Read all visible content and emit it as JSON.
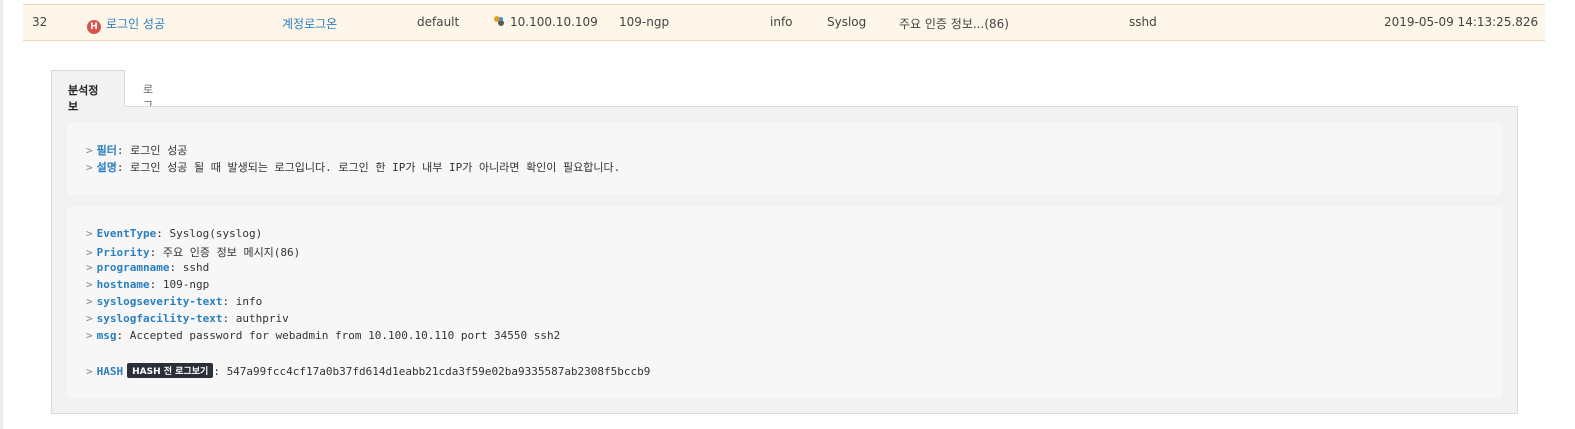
{
  "row": {
    "index": "32",
    "badge": "H",
    "event_name": "로그인 성공",
    "category": "계정로그온",
    "group": "default",
    "ip": "10.100.10.109",
    "host": "109-ngp",
    "level": "info",
    "type": "Syslog",
    "message": "주요 인증 정보...(86)",
    "program": "sshd",
    "time": "2019-05-09 14:13:25.826"
  },
  "tabs": [
    {
      "label": "분석정보",
      "active": true
    },
    {
      "label": "로그상세",
      "active": false
    }
  ],
  "analysis": {
    "filter_key": "필터",
    "filter_value": "로그인 성공",
    "desc_key": "설명",
    "desc_value": "로그인 성공 될 때 발생되는 로그입니다. 로그인 한 IP가 내부 IP가 아니라면 확인이 필요합니다."
  },
  "fields": [
    {
      "key": "EventType",
      "value": "Syslog(syslog)"
    },
    {
      "key": "Priority",
      "value": "주요 인증 정보 메시지(86)"
    },
    {
      "key": "programname",
      "value": "sshd"
    },
    {
      "key": "hostname",
      "value": "109-ngp"
    },
    {
      "key": "syslogseverity-text",
      "value": "info"
    },
    {
      "key": "syslogfacility-text",
      "value": "authpriv"
    },
    {
      "key": "msg",
      "value": "Accepted password for webadmin from 10.100.10.110 port 34550 ssh2"
    }
  ],
  "hash": {
    "key": "HASH",
    "button_label": "HASH 전 로그보기",
    "value": "547a99fcc4cf17a0b37fd614d1eabb21cda3f59e02ba9335587ab2308f5bccb9"
  },
  "colors": {
    "link": "#2a7fbf",
    "badge": "#d9534f",
    "row_highlight": "#fdf6e9"
  }
}
